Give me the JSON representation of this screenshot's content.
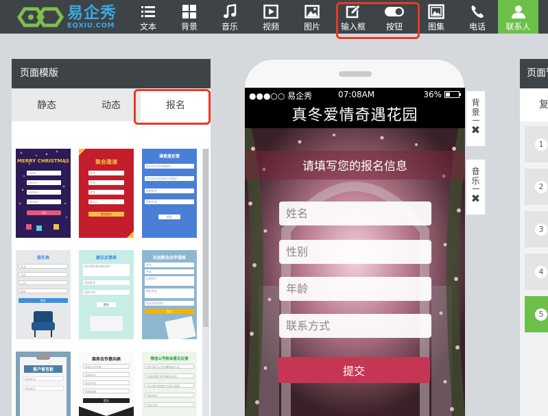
{
  "topbar": {
    "logo_cn": "易企秀",
    "logo_en": "EQXIU.COM",
    "tools": [
      {
        "label": "文本",
        "icon": "text-list-icon"
      },
      {
        "label": "背景",
        "icon": "grid-icon"
      },
      {
        "label": "音乐",
        "icon": "music-note-icon"
      },
      {
        "label": "视频",
        "icon": "video-play-icon"
      },
      {
        "label": "图片",
        "icon": "image-icon"
      },
      {
        "label": "输入框",
        "icon": "edit-input-icon"
      },
      {
        "label": "按钮",
        "icon": "toggle-button-icon"
      },
      {
        "label": "图集",
        "icon": "gallery-icon"
      },
      {
        "label": "电话",
        "icon": "phone-icon"
      },
      {
        "label": "联系人",
        "icon": "contact-person-icon"
      }
    ],
    "accent": "#6cc04a"
  },
  "left_panel": {
    "title": "页面模版",
    "tabs": [
      {
        "label": "静态"
      },
      {
        "label": "动态"
      },
      {
        "label": "报名",
        "active": true
      }
    ],
    "templates": [
      {
        "title": "MERRY CHRISTMAS",
        "fields": [
          "name",
          "phone",
          "address",
          "number"
        ],
        "button": "Go"
      },
      {
        "title": "聚会邀请",
        "fields": [
          "姓名",
          "手机",
          "地址",
          "参与人"
        ],
        "button": "提交报名"
      },
      {
        "title": "满意度反馈",
        "fields": [
          "您对本次活动满意吗",
          "您对本次活动有什么建议?",
          "您的姓名",
          "您的手机"
        ],
        "button": "提交"
      },
      {
        "title": "报名表",
        "fields": [
          "姓名",
          "手机",
          "公司",
          "职务"
        ],
        "button": "提交"
      },
      {
        "title": "建议反馈表",
        "fields": [
          "您对我们有何建议呢?",
          "您的姓名",
          "您的手机"
        ],
        "button": "提交"
      },
      {
        "title": "社团新会员申请表",
        "fields": [
          "姓名",
          "手机",
          "自我简介",
          "擅长专长",
          "您从何处得知?"
        ],
        "button": "提交"
      },
      {
        "title": "客户留言板",
        "fields": [
          "您的姓名",
          "您的留言"
        ],
        "button": ""
      },
      {
        "title": "商务合作意向表",
        "fields": [
          "您的公司名称",
          "您的姓名",
          "您的手机",
          "您的邮箱"
        ],
        "button": "提交"
      },
      {
        "title": "微信公号粉丝意见反馈",
        "fields": [
          "您在我们公号中最喜欢什么",
          "您希望我们提供哪些内容",
          "您对我们的哪些方面不满意",
          "您的姓名",
          "您的手机"
        ],
        "button": ""
      }
    ]
  },
  "phone": {
    "status": {
      "carrier": "●●●○○ 易企秀",
      "time": "07:08AM",
      "battery": "36%",
      "battery_level": 0.36
    },
    "title": "真冬爱情奇遇花园",
    "subtitle": "请填写您的报名信息",
    "fields": [
      {
        "placeholder": "姓名"
      },
      {
        "placeholder": "性别"
      },
      {
        "placeholder": "年龄"
      },
      {
        "placeholder": "联系方式"
      }
    ],
    "submit": "提交"
  },
  "side_buttons": [
    {
      "label": "背景",
      "close": "✖"
    },
    {
      "label": "音乐",
      "close": "✖"
    }
  ],
  "right_panel": {
    "title": "页面管理",
    "sub": "复制",
    "pages": [
      "1",
      "2",
      "3",
      "4",
      "5"
    ],
    "active_page": "5"
  }
}
